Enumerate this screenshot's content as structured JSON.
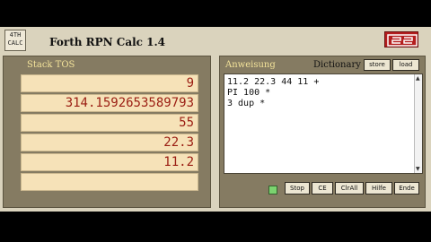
{
  "window": {
    "title": "Forth RPN Calc 1.4",
    "logo_text": "4TH CALC"
  },
  "stack_panel": {
    "label": "Stack TOS",
    "rows": [
      "9",
      "314.1592653589793",
      "55",
      "22.3",
      "11.2",
      ""
    ]
  },
  "input_panel": {
    "tab_label": "Anweisung",
    "dictionary_label": "Dictionary",
    "store_label": "store",
    "load_label": "load",
    "lines": [
      "11.2 22.3 44 11 +",
      "PI 100 *",
      "3 dup *"
    ]
  },
  "controls": {
    "stop": "Stop",
    "ce": "CE",
    "clrall": "ClrAll",
    "hilfe": "Hilfe",
    "ende": "Ende"
  },
  "colors": {
    "panel": "#857b62",
    "cell": "#f6e2b8",
    "value_text": "#9a1d12",
    "label_text": "#f3e39a",
    "brand_red": "#b41e1e",
    "led_green": "#7bd36f"
  },
  "icons": {
    "logo": "4th-calc-logo",
    "brand": "brand-logo",
    "status": "status-led-icon"
  }
}
